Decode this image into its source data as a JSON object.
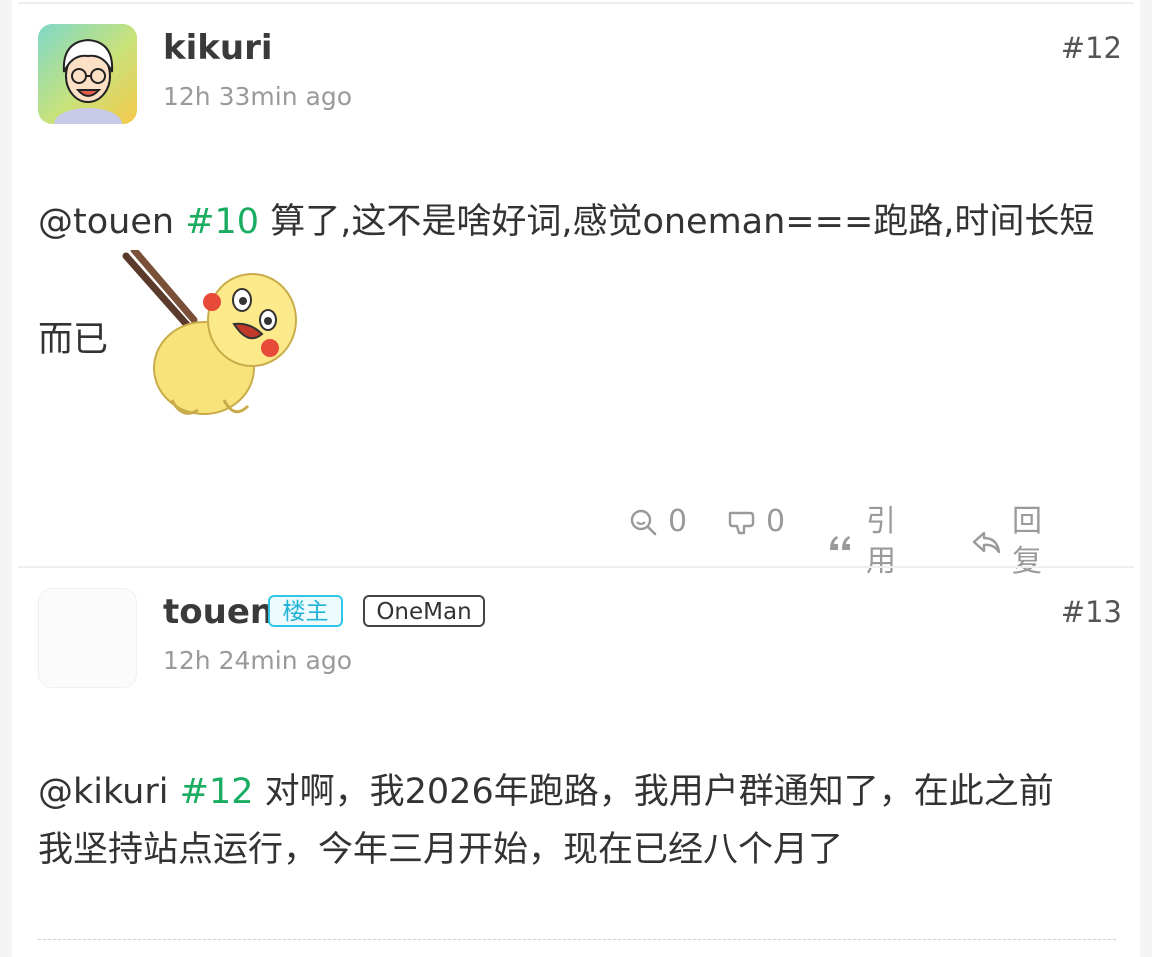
{
  "posts": [
    {
      "username": "kikuri",
      "time": "12h 33min ago",
      "floor": "#12",
      "content": {
        "mention": "@touen",
        "mention_floor": "#10",
        "text_line1": "算了,这不是啥好词,感觉oneman===跑路,时间长短",
        "text_line2": "而已"
      },
      "actions": {
        "like_count": "0",
        "dislike_count": "0",
        "quote_label": "引用",
        "reply_label": "回复"
      }
    },
    {
      "username": "touen",
      "badge_op": "楼主",
      "badge_tag": "OneMan",
      "time": "12h 24min ago",
      "floor": "#13",
      "content": {
        "mention": "@kikuri",
        "mention_floor": "#12",
        "text_line1": "对啊，我2026年跑路，我用户群通知了，在此之前",
        "text_line2": "我坚持站点运行，今年三月开始，现在已经八个月了"
      }
    }
  ],
  "icons": {
    "like": "zoom-like-icon",
    "dislike": "thumb-down-icon",
    "quote": "quote-icon",
    "reply": "reply-icon"
  },
  "colors": {
    "mention_number": "#1aad62",
    "op_badge": "#2ec7e8"
  }
}
